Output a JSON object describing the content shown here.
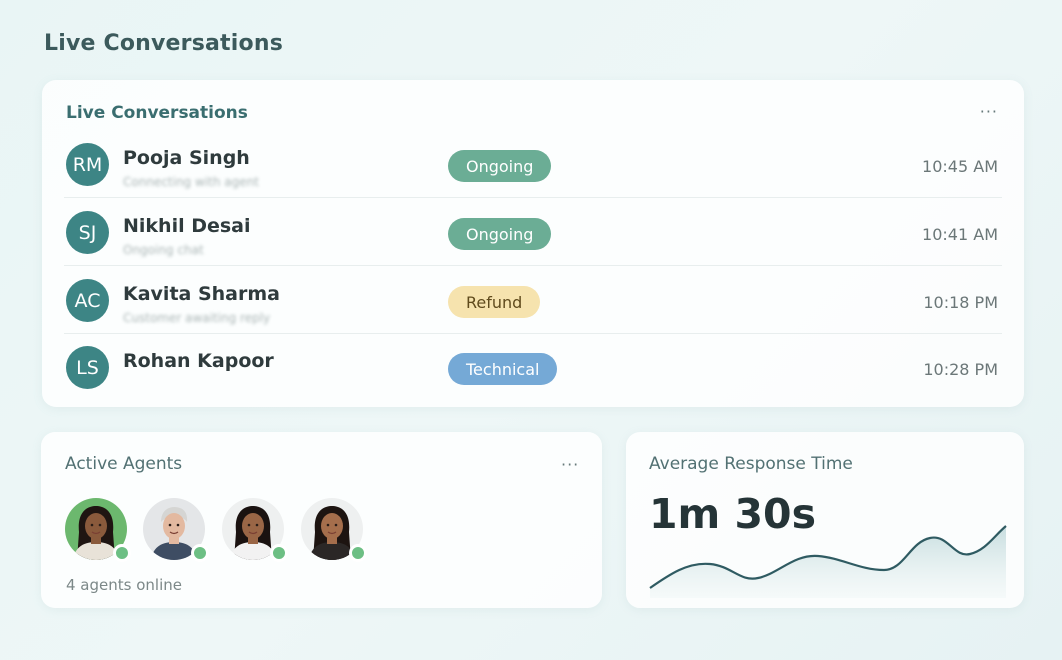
{
  "page": {
    "title": "Live Conversations"
  },
  "conversations": {
    "title": "Live Conversations",
    "more_label": "···",
    "rows": [
      {
        "initials": "RM",
        "name": "Pooja Singh",
        "preview": "Connecting with agent",
        "status": "Ongoing",
        "status_kind": "ongoing",
        "time": "10:45 AM"
      },
      {
        "initials": "SJ",
        "name": "Nikhil Desai",
        "preview": "Ongoing chat",
        "status": "Ongoing",
        "status_kind": "ongoing",
        "time": "10:41 AM"
      },
      {
        "initials": "AC",
        "name": "Kavita Sharma",
        "preview": "Customer awaiting reply",
        "status": "Refund",
        "status_kind": "refund",
        "time": "10:18 PM"
      },
      {
        "initials": "LS",
        "name": "Rohan Kapoor",
        "preview": "",
        "status": "Technical",
        "status_kind": "technical",
        "time": "10:28 PM"
      }
    ]
  },
  "agents": {
    "title": "Active Agents",
    "more_label": "···",
    "count_text": "4 agents online",
    "avatars": [
      {
        "name": "agent-1",
        "bg": "#6cb86e",
        "skin": "#8a5a3c",
        "hair": "#1f1512",
        "shirt": "#e8e2d8",
        "hair_style": "long"
      },
      {
        "name": "agent-2",
        "bg": "#e4e6e8",
        "skin": "#e3b9a0",
        "hair": "#d5d5d3",
        "shirt": "#3e4d63",
        "hair_style": "short"
      },
      {
        "name": "agent-3",
        "bg": "#eef0f0",
        "skin": "#9a6646",
        "hair": "#1a1210",
        "shirt": "#f2f2f2",
        "hair_style": "long"
      },
      {
        "name": "agent-4",
        "bg": "#eef0f0",
        "skin": "#a56e4c",
        "hair": "#1d1411",
        "shirt": "#2b2726",
        "hair_style": "long"
      }
    ]
  },
  "response": {
    "title": "Average Response Time",
    "value": "1m 30s"
  },
  "colors": {
    "ongoing_bg": "#6bad95",
    "ongoing_fg": "#ffffff",
    "refund_bg": "#f6e3ae",
    "refund_fg": "#5f4a1c",
    "technical_bg": "#75a9d6",
    "technical_fg": "#ffffff",
    "avatar_bg": "#3d8585",
    "online_dot": "#6dbf84",
    "sparkline": "#2f5b62"
  }
}
